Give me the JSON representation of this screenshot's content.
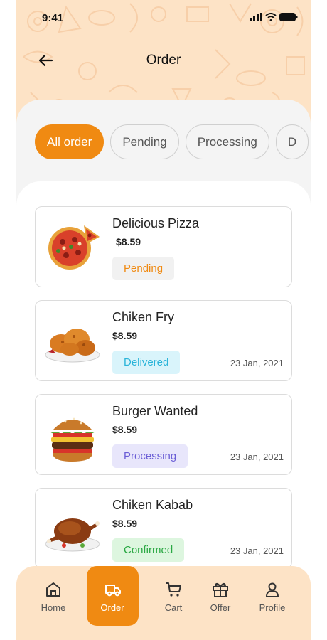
{
  "status": {
    "time": "9:41"
  },
  "header": {
    "title": "Order"
  },
  "tabs": [
    {
      "label": "All order",
      "active": true
    },
    {
      "label": "Pending",
      "active": false
    },
    {
      "label": "Processing",
      "active": false
    },
    {
      "label": "D",
      "active": false
    }
  ],
  "orders": [
    {
      "name": "Delicious Pizza",
      "price": "$8.59",
      "status": "Pending",
      "date": "",
      "image": "pizza-image"
    },
    {
      "name": "Chiken Fry",
      "price": "$8.59",
      "status": "Delivered",
      "date": "23 Jan, 2021",
      "image": "fried-chicken-image"
    },
    {
      "name": "Burger Wanted",
      "price": "$8.59",
      "status": "Processing",
      "date": "23 Jan, 2021",
      "image": "burger-image"
    },
    {
      "name": "Chiken Kabab",
      "price": "$8.59",
      "status": "Confirmed",
      "date": "23 Jan, 2021",
      "image": "roast-chicken-image"
    }
  ],
  "nav": [
    {
      "label": "Home",
      "icon": "home-icon",
      "active": false
    },
    {
      "label": "Order",
      "icon": "truck-icon",
      "active": true
    },
    {
      "label": "Cart",
      "icon": "cart-icon",
      "active": false
    },
    {
      "label": "Offer",
      "icon": "gift-icon",
      "active": false
    },
    {
      "label": "Profile",
      "icon": "profile-icon",
      "active": false
    }
  ],
  "colors": {
    "accent": "#f08a12",
    "header_bg": "#fde3c6",
    "pending_bg": "#f1f1f1",
    "pending_text": "#f08a12",
    "delivered_bg": "#d9f4fb",
    "delivered_text": "#2ab4d9",
    "processing_bg": "#e8e6fb",
    "processing_text": "#6b5ed6",
    "confirmed_bg": "#ddf6df",
    "confirmed_text": "#2aa843"
  }
}
